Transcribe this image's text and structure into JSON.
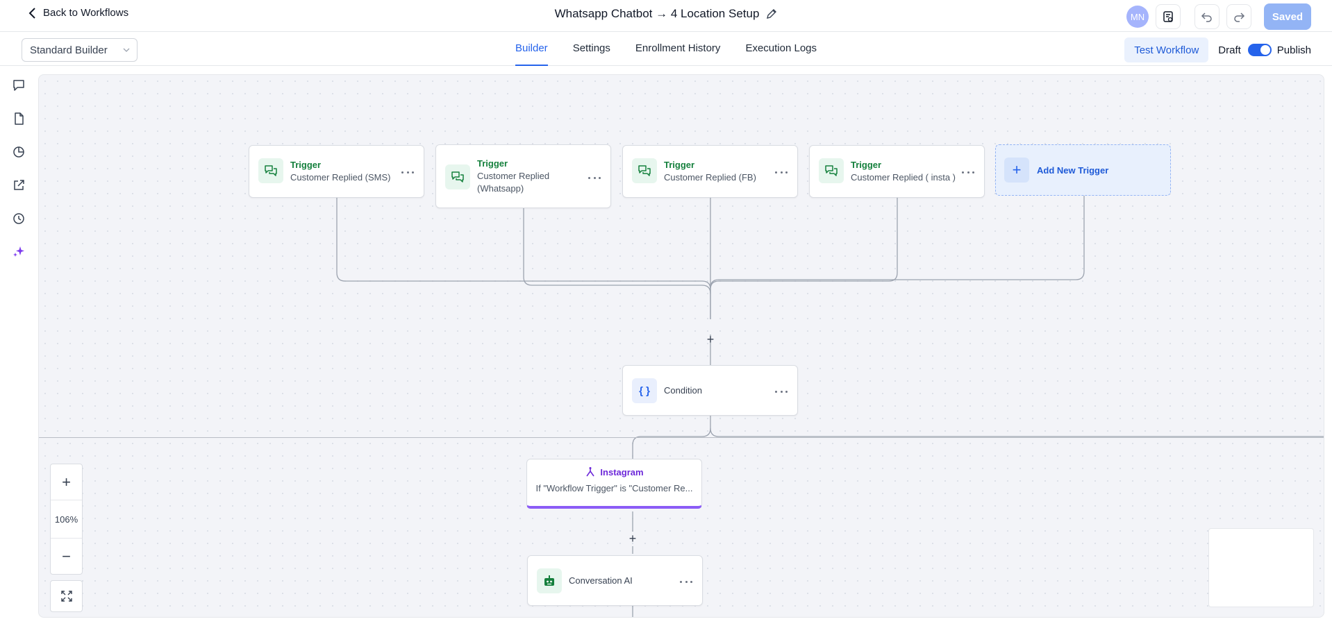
{
  "header": {
    "back_label": "Back to Workflows",
    "title": "Whatsapp Chatbot → 4 Location Setup",
    "avatar_initials": "MN",
    "saved_label": "Saved"
  },
  "subbar": {
    "builder_mode": "Standard Builder",
    "tabs": [
      {
        "label": "Builder",
        "active": true
      },
      {
        "label": "Settings",
        "active": false
      },
      {
        "label": "Enrollment History",
        "active": false
      },
      {
        "label": "Execution Logs",
        "active": false
      }
    ],
    "test_label": "Test Workflow",
    "draft_label": "Draft",
    "publish_label": "Publish",
    "published": true
  },
  "triggers": [
    {
      "title": "Trigger",
      "subtitle": "Customer Replied (SMS)"
    },
    {
      "title": "Trigger",
      "subtitle": "Customer Replied (Whatsapp)"
    },
    {
      "title": "Trigger",
      "subtitle": "Customer Replied (FB)"
    },
    {
      "title": "Trigger",
      "subtitle": "Customer Replied ( insta )"
    }
  ],
  "add_trigger_label": "Add New Trigger",
  "condition": {
    "label": "Condition",
    "icon_text": "{ }"
  },
  "branch": {
    "title": "Instagram",
    "subtitle": "If \"Workflow Trigger\" is \"Customer Re..."
  },
  "action": {
    "label": "Conversation AI"
  },
  "zoom": {
    "level": "106%",
    "plus": "+",
    "minus": "−"
  },
  "plus_glyph": "+",
  "colors": {
    "accent": "#2563eb",
    "trigger_green": "#15803d",
    "branch_purple": "#8b5cf6",
    "saved_disabled": "#93b4f5"
  }
}
